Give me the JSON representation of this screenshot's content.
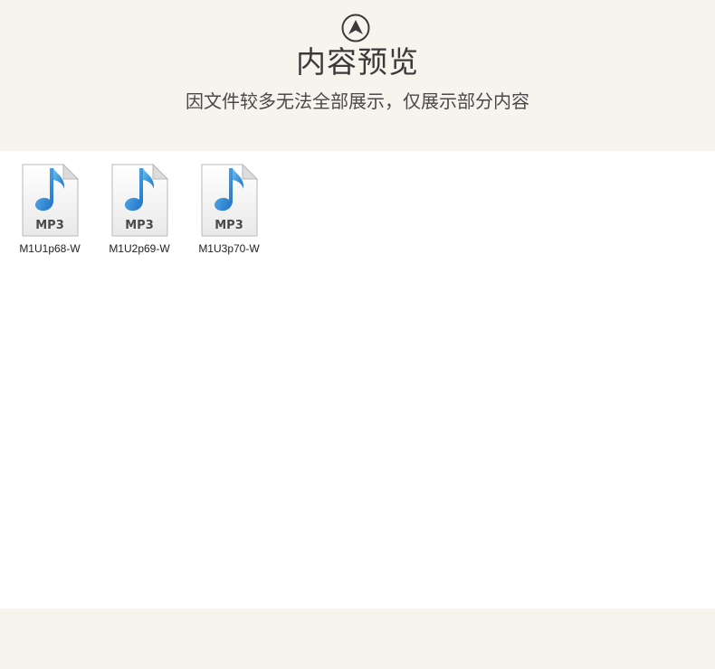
{
  "header": {
    "title": "内容预览",
    "subtitle": "因文件较多无法全部展示，仅展示部分内容",
    "up_icon": "circle-up-arrow-icon"
  },
  "colors": {
    "header_bg": "#f7f4ee",
    "note_blue": "#2f8fd6",
    "text_dark": "#3a3a3a"
  },
  "files": [
    {
      "name": "M1U1p68-W",
      "type_label": "MP3",
      "icon": "mp3-file-icon"
    },
    {
      "name": "M1U2p69-W",
      "type_label": "MP3",
      "icon": "mp3-file-icon"
    },
    {
      "name": "M1U3p70-W",
      "type_label": "MP3",
      "icon": "mp3-file-icon"
    }
  ]
}
